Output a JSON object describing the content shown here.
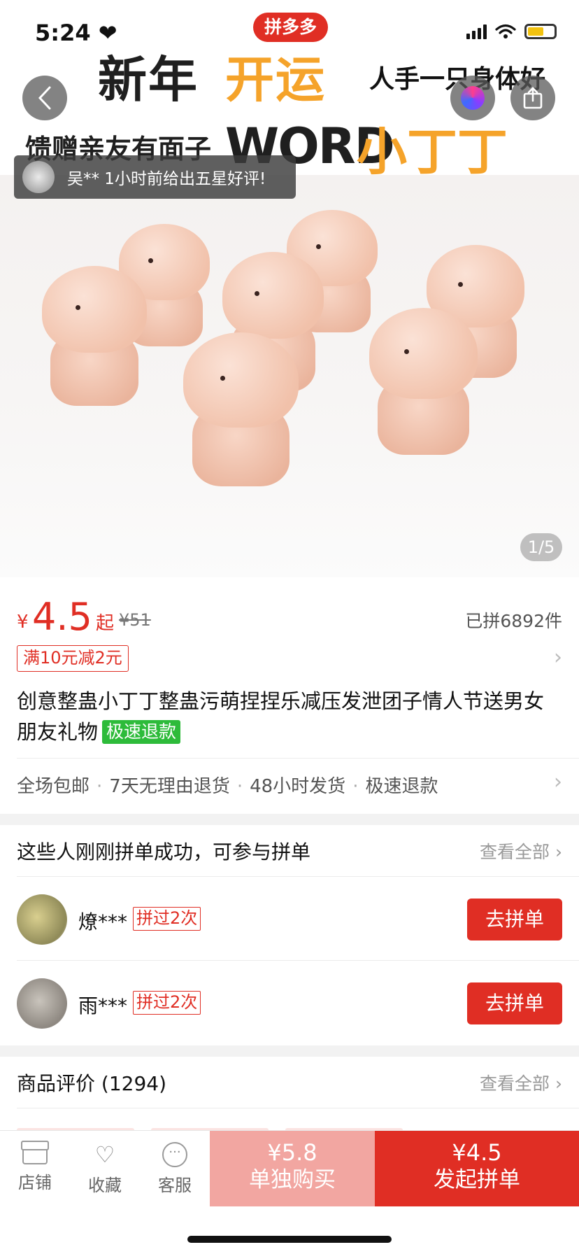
{
  "status_bar": {
    "time": "5:24 ❤"
  },
  "hero": {
    "brand_badge": "拼多多",
    "banner": {
      "line1_dark": "新年",
      "line1_orange": "开运",
      "line1_right": "人手一只身体好",
      "line2_left": "馈赠亲友有面子",
      "line2_dark": "WORD",
      "line2_orange": "小丁丁"
    },
    "toast": {
      "text": "吴** 1小时前给出五星好评!"
    },
    "page_indicator": "1/5"
  },
  "product": {
    "price_symbol": "¥",
    "price": "4.5",
    "price_suffix": "起",
    "original_price": "¥51",
    "sold": "已拼6892件",
    "coupon": "满10元减2元",
    "title": "创意整蛊小丁丁整蛊污萌捏捏乐减压发泄团子情人节送男女朋友礼物",
    "title_tag": "极速退款",
    "services": [
      "全场包邮",
      "7天无理由退货",
      "48小时发货",
      "极速退款"
    ]
  },
  "group_buy": {
    "title": "这些人刚刚拼单成功，可参与拼单",
    "more": "查看全部 ›",
    "buyers": [
      {
        "name": "燎***",
        "badge": "拼过2次",
        "button": "去拼单"
      },
      {
        "name": "雨***",
        "badge": "拼过2次",
        "button": "去拼单"
      }
    ]
  },
  "reviews": {
    "title": "商品评价 (1294)",
    "more": "查看全部 ›"
  },
  "bottom_bar": {
    "store": "店铺",
    "favorite": "收藏",
    "service": "客服",
    "single_price": "¥5.8",
    "single_label": "单独购买",
    "group_price": "¥4.5",
    "group_label": "发起拼单"
  },
  "colors": {
    "accent": "#e02e24",
    "green_tag": "#2dbb3a",
    "banner_orange": "#f5a32a"
  }
}
